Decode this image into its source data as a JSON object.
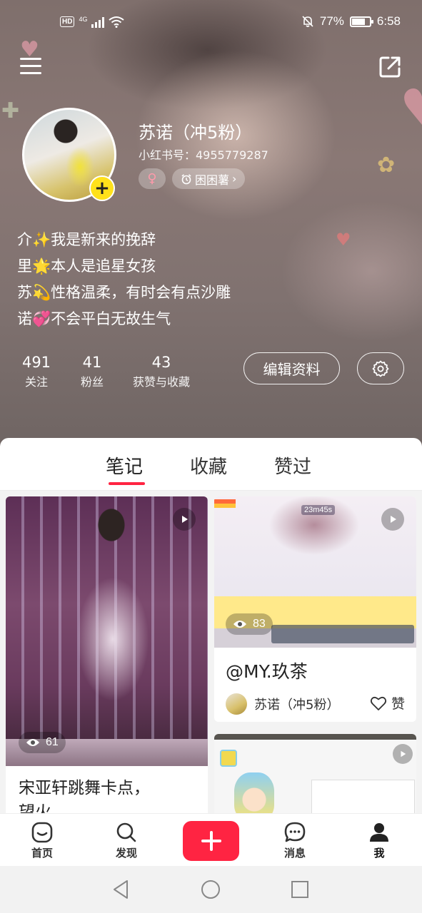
{
  "status_bar": {
    "hd": "HD",
    "network": "4G",
    "battery_percent": "77%",
    "battery_level": 0.77,
    "time": "6:58"
  },
  "header": {
    "menu_icon": "hamburger-menu-icon",
    "share_icon": "share-export-icon"
  },
  "profile": {
    "nickname": "苏诺（冲5粉）",
    "user_id": "小红书号：4955779287",
    "gender_symbol": "♀",
    "tag_label": "困困薯",
    "bio_lines": [
      "介✨我是新来的挽辞",
      "里🌟本人是追星女孩",
      "苏💫性格温柔，有时会有点沙雕",
      "诺💞不会平白无故生气"
    ],
    "stats": [
      {
        "num": "491",
        "label": "关注"
      },
      {
        "num": "41",
        "label": "粉丝"
      },
      {
        "num": "43",
        "label": "获赞与收藏"
      }
    ],
    "edit_label": "编辑资料"
  },
  "tabs": [
    {
      "label": "笔记",
      "active": true
    },
    {
      "label": "收藏",
      "active": false
    },
    {
      "label": "赞过",
      "active": false
    }
  ],
  "notes": [
    {
      "title": "宋亚轩跳舞卡点，\n望火",
      "views": "61",
      "type": "video"
    },
    {
      "title": "@MY.玖茶",
      "views": "83",
      "timer": "23m45s",
      "author": "苏诺（冲5粉）",
      "like_label": "赞",
      "type": "video"
    },
    {
      "type": "video"
    }
  ],
  "bottom_nav": [
    {
      "label": "首页",
      "icon": "home-icon"
    },
    {
      "label": "发现",
      "icon": "search-icon"
    },
    {
      "label": "",
      "icon": "plus-icon"
    },
    {
      "label": "消息",
      "icon": "message-icon"
    },
    {
      "label": "我",
      "icon": "person-icon"
    }
  ],
  "colors": {
    "accent": "#ff2442",
    "plus_badge": "#ffe11a"
  }
}
